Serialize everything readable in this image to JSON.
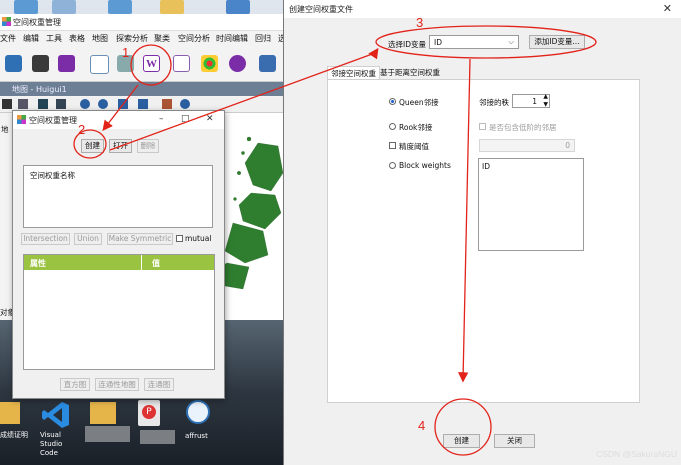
{
  "main_window": {
    "title": "空间权重管理",
    "menu": [
      "文件",
      "编辑",
      "工具",
      "表格",
      "地图",
      "探索分析",
      "聚类",
      "空间分析",
      "时间编辑",
      "回归",
      "选"
    ],
    "map_window_title": "地图 - Huigui1",
    "side_labels": [
      "地",
      "对象",
      "后"
    ]
  },
  "weights_manager": {
    "title": "空间权重管理",
    "buttons": {
      "create": "创建",
      "open": "打开",
      "delete": "删除"
    },
    "weights_name_header": "空间权重名称",
    "ops": {
      "intersection": "Intersection",
      "union": "Union",
      "make_symmetric": "Make Symmetric",
      "mutual": "mutual"
    },
    "table_headers": [
      "属性",
      "值"
    ],
    "bottom_buttons": [
      "直方图",
      "连通性地图",
      "连通图"
    ]
  },
  "create_dialog": {
    "title": "创建空间权重文件",
    "id_label": "选择ID变量",
    "id_value": "ID",
    "add_id_button": "添加ID变量...",
    "tabs": [
      "邻接空间权重",
      "基于距离空间权重"
    ],
    "queen": "Queen邻接",
    "rook": "Rook邻接",
    "precision": "精度阈值",
    "precision_value": "0",
    "block_weights": "Block weights",
    "order_label": "邻接的秩",
    "order_value": "1",
    "include_lower": "是否包含低阶的邻居",
    "block_list": [
      "ID"
    ],
    "create_button": "创建",
    "close_button": "关闭"
  },
  "taskbar": [
    "Visual Studio Code",
    "affrust",
    "成绩证明"
  ],
  "annotations": [
    "1",
    "2",
    "3",
    "4"
  ],
  "watermark": "CSDN @SakuraNGU",
  "colors": {
    "annotation": "#e2231a",
    "table_header": "#9ac341",
    "map_polygons": "#2f7d2f"
  }
}
